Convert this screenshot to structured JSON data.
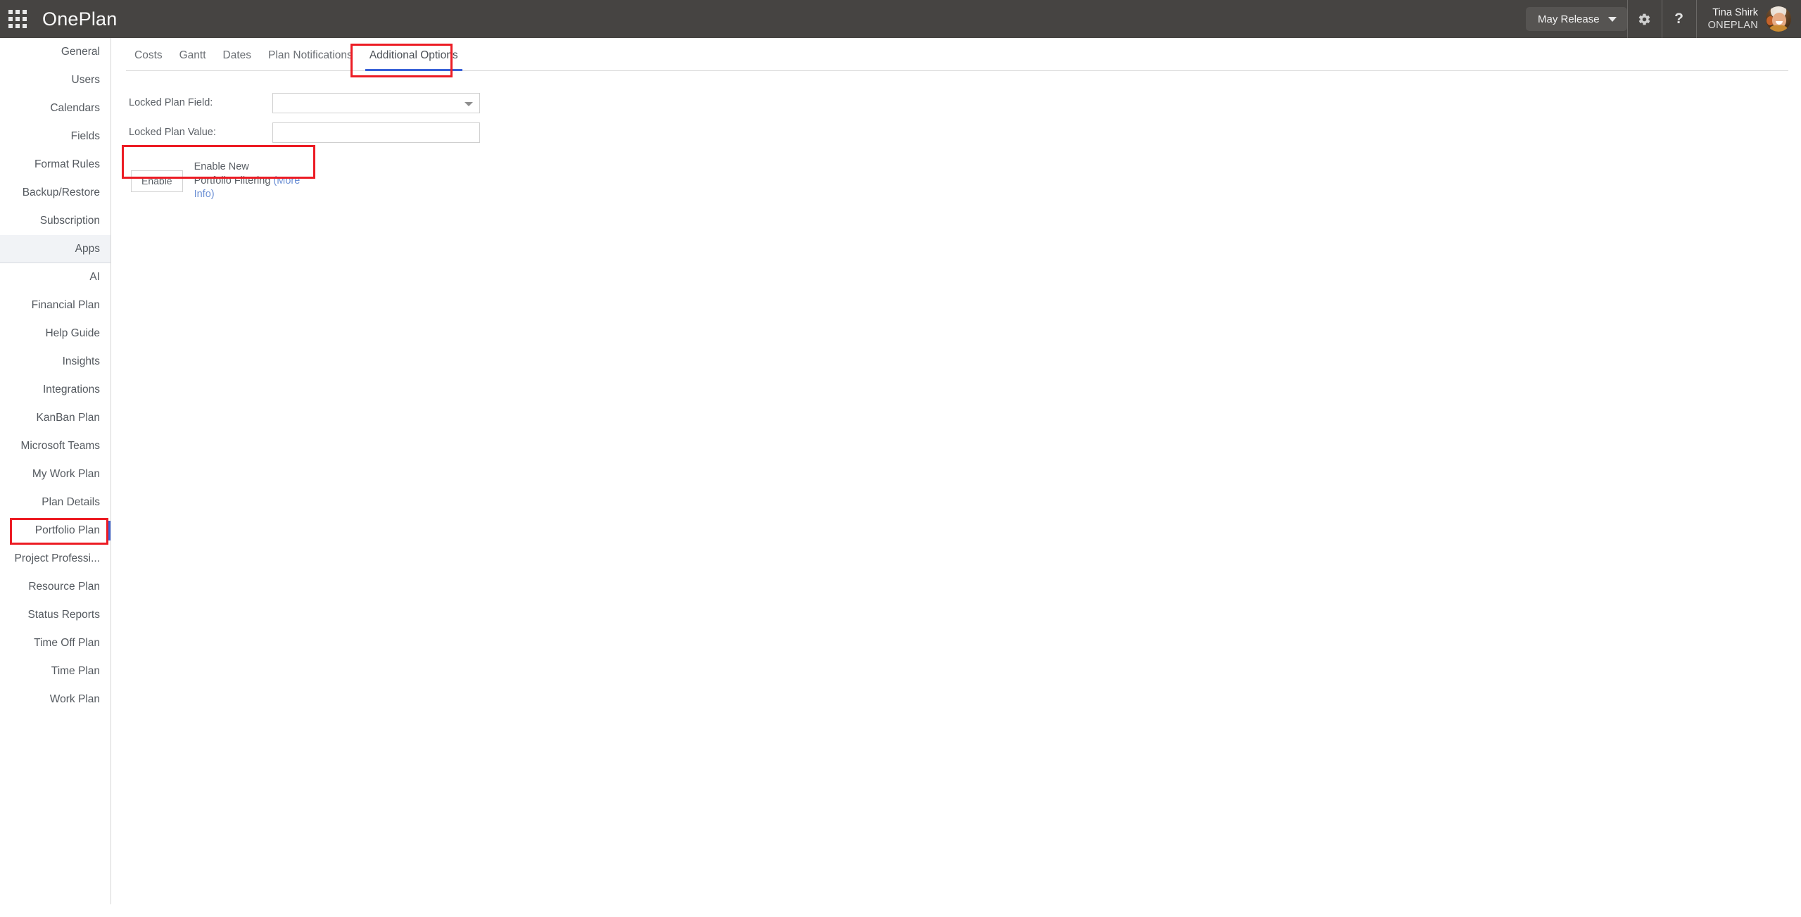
{
  "header": {
    "app_icon": "apps-grid-icon",
    "brand": "OnePlan",
    "release_selector": "May Release",
    "settings_icon": "gear-icon",
    "help_icon": "question-mark-icon",
    "user": {
      "name": "Tina Shirk",
      "tenant": "ONEPLAN",
      "avatar": "user-avatar"
    }
  },
  "sidebar": {
    "items": [
      {
        "label": "General",
        "selected": false,
        "active": false
      },
      {
        "label": "Users",
        "selected": false,
        "active": false
      },
      {
        "label": "Calendars",
        "selected": false,
        "active": false
      },
      {
        "label": "Fields",
        "selected": false,
        "active": false
      },
      {
        "label": "Format Rules",
        "selected": false,
        "active": false
      },
      {
        "label": "Backup/Restore",
        "selected": false,
        "active": false
      },
      {
        "label": "Subscription",
        "selected": false,
        "active": false
      },
      {
        "label": "Apps",
        "selected": true,
        "active": false
      },
      {
        "label": "AI",
        "selected": false,
        "active": false
      },
      {
        "label": "Financial Plan",
        "selected": false,
        "active": false
      },
      {
        "label": "Help Guide",
        "selected": false,
        "active": false
      },
      {
        "label": "Insights",
        "selected": false,
        "active": false
      },
      {
        "label": "Integrations",
        "selected": false,
        "active": false
      },
      {
        "label": "KanBan Plan",
        "selected": false,
        "active": false
      },
      {
        "label": "Microsoft Teams",
        "selected": false,
        "active": false
      },
      {
        "label": "My Work Plan",
        "selected": false,
        "active": false
      },
      {
        "label": "Plan Details",
        "selected": false,
        "active": false
      },
      {
        "label": "Portfolio Plan",
        "selected": false,
        "active": true
      },
      {
        "label": "Project Professi...",
        "selected": false,
        "active": false
      },
      {
        "label": "Resource Plan",
        "selected": false,
        "active": false
      },
      {
        "label": "Status Reports",
        "selected": false,
        "active": false
      },
      {
        "label": "Time Off Plan",
        "selected": false,
        "active": false
      },
      {
        "label": "Time Plan",
        "selected": false,
        "active": false
      },
      {
        "label": "Work Plan",
        "selected": false,
        "active": false
      }
    ]
  },
  "main": {
    "tabs": [
      {
        "label": "Costs",
        "active": false
      },
      {
        "label": "Gantt",
        "active": false
      },
      {
        "label": "Dates",
        "active": false
      },
      {
        "label": "Plan Notifications",
        "active": false
      },
      {
        "label": "Additional Options",
        "active": true
      }
    ],
    "form": {
      "locked_plan_field_label": "Locked Plan Field:",
      "locked_plan_field_value": "",
      "locked_plan_field_placeholder": "",
      "locked_plan_value_label": "Locked Plan Value:",
      "locked_plan_value_value": "",
      "locked_plan_value_placeholder": "",
      "enable_button_label": "Enable",
      "enable_description_line1": "Enable New",
      "enable_description_line2": "Portfolio Filtering",
      "more_info_label": "(More Info)"
    }
  },
  "annotations": {
    "accent_blue": "#3a62d8",
    "highlight_red": "#ec1c24",
    "boxes": [
      {
        "name": "portfolio-plan-highlight"
      },
      {
        "name": "additional-options-tab-highlight"
      },
      {
        "name": "enable-portfolio-filtering-highlight"
      }
    ]
  }
}
